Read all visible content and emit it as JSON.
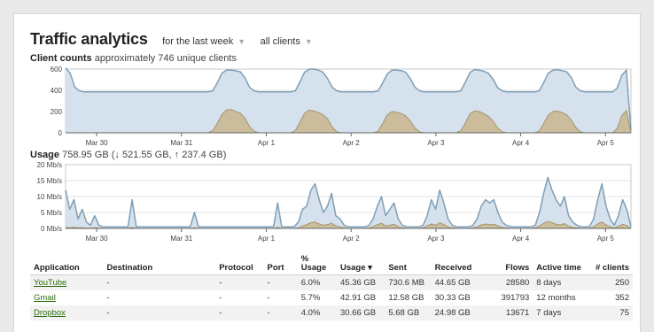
{
  "header": {
    "title": "Traffic analytics",
    "time_filter": "for the last week",
    "client_filter": "all clients"
  },
  "client_counts": {
    "label": "Client counts",
    "summary": "approximately 746 unique clients"
  },
  "usage": {
    "label": "Usage",
    "summary": "758.95 GB (↓ 521.55 GB, ↑ 237.4 GB)"
  },
  "table": {
    "headers": {
      "application": "Application",
      "destination": "Destination",
      "protocol": "Protocol",
      "port": "Port",
      "pct_usage": "% Usage",
      "usage": "Usage ▾",
      "sent": "Sent",
      "received": "Received",
      "flows": "Flows",
      "active_time": "Active time",
      "clients": "# clients"
    },
    "rows": [
      {
        "application": "YouTube",
        "destination": "-",
        "protocol": "-",
        "port": "-",
        "pct_usage": "6.0%",
        "usage": "45.36 GB",
        "sent": "730.6 MB",
        "received": "44.65 GB",
        "flows": "28580",
        "active_time": "8 days",
        "clients": "250"
      },
      {
        "application": "Gmail",
        "destination": "-",
        "protocol": "-",
        "port": "-",
        "pct_usage": "5.7%",
        "usage": "42.91 GB",
        "sent": "12.58 GB",
        "received": "30.33 GB",
        "flows": "391793",
        "active_time": "12 months",
        "clients": "352"
      },
      {
        "application": "Dropbox",
        "destination": "-",
        "protocol": "-",
        "port": "-",
        "pct_usage": "4.0%",
        "usage": "30.66 GB",
        "sent": "5.68 GB",
        "received": "24.98 GB",
        "flows": "13671",
        "active_time": "7 days",
        "clients": "75"
      }
    ]
  },
  "colors": {
    "total_fill": "#d5e1ec",
    "total_line": "#7f9fb5",
    "secondary_fill": "#cbbd9c",
    "secondary_line": "#a4946e",
    "link": "#2a6e0c"
  },
  "chart_data": [
    {
      "type": "area",
      "title": "Client counts",
      "x_ticks": [
        "Mar 30",
        "Mar 31",
        "Apr 1",
        "Apr 2",
        "Apr 3",
        "Apr 4",
        "Apr 5"
      ],
      "y_ticks": [
        "0",
        "200",
        "400",
        "600"
      ],
      "ylim": [
        0,
        600
      ],
      "grid": true,
      "series": [
        {
          "values": [
            610,
            560,
            430,
            395,
            385,
            385,
            385,
            385,
            385,
            385,
            385,
            385,
            385,
            385,
            385,
            385,
            385,
            385,
            385,
            385,
            385,
            385,
            385,
            385,
            385,
            385,
            385,
            385,
            385,
            385,
            385,
            385,
            395,
            470,
            560,
            590,
            590,
            585,
            575,
            520,
            430,
            395,
            385,
            385,
            385,
            385,
            385,
            385,
            385,
            385,
            395,
            480,
            570,
            600,
            600,
            590,
            570,
            510,
            430,
            395,
            385,
            385,
            385,
            385,
            385,
            385,
            385,
            385,
            395,
            470,
            555,
            590,
            590,
            585,
            570,
            510,
            430,
            395,
            385,
            385,
            385,
            385,
            385,
            385,
            385,
            385,
            395,
            480,
            570,
            595,
            590,
            580,
            560,
            505,
            425,
            395,
            385,
            385,
            385,
            385,
            385,
            385,
            385,
            395,
            470,
            560,
            590,
            595,
            585,
            575,
            520,
            430,
            395,
            385,
            385,
            385,
            385,
            385,
            385,
            385,
            420,
            540,
            590,
            20
          ]
        },
        {
          "values": [
            0,
            0,
            0,
            0,
            0,
            0,
            0,
            0,
            0,
            0,
            0,
            0,
            0,
            0,
            0,
            0,
            0,
            0,
            0,
            0,
            0,
            0,
            0,
            0,
            0,
            0,
            0,
            0,
            0,
            0,
            0,
            0,
            20,
            90,
            170,
            215,
            220,
            200,
            185,
            140,
            60,
            15,
            0,
            0,
            0,
            0,
            0,
            0,
            0,
            0,
            20,
            100,
            185,
            215,
            205,
            190,
            170,
            130,
            55,
            10,
            0,
            0,
            0,
            0,
            0,
            0,
            0,
            0,
            15,
            90,
            170,
            200,
            195,
            180,
            160,
            110,
            45,
            10,
            0,
            0,
            0,
            0,
            0,
            0,
            0,
            0,
            20,
            95,
            180,
            205,
            200,
            180,
            155,
            110,
            45,
            10,
            0,
            0,
            0,
            0,
            0,
            0,
            0,
            15,
            85,
            165,
            200,
            205,
            190,
            170,
            120,
            50,
            10,
            0,
            0,
            0,
            0,
            0,
            0,
            0,
            40,
            160,
            210,
            0
          ]
        }
      ]
    },
    {
      "type": "area",
      "title": "Usage",
      "x_ticks": [
        "Mar 30",
        "Mar 31",
        "Apr 1",
        "Apr 2",
        "Apr 3",
        "Apr 4",
        "Apr 5"
      ],
      "y_ticks": [
        "0 Mb/s",
        "5 Mb/s",
        "10 Mb/s",
        "15 Mb/s",
        "20 Mb/s"
      ],
      "ylim": [
        0,
        20
      ],
      "grid": true,
      "series": [
        {
          "values": [
            12,
            6,
            9,
            3,
            6,
            2,
            1,
            4,
            1,
            0.5,
            0.5,
            0.5,
            0.5,
            0.5,
            0.5,
            0.5,
            9,
            0.5,
            0.5,
            0.5,
            0.5,
            0.5,
            0.5,
            0.5,
            0.5,
            0.5,
            0.5,
            0.5,
            0.5,
            0.5,
            0.5,
            5,
            0.5,
            0.5,
            0.5,
            0.5,
            0.5,
            0.5,
            0.5,
            0.5,
            0.5,
            0.5,
            0.5,
            0.5,
            0.5,
            0.5,
            0.5,
            0.5,
            0.5,
            0.5,
            0.5,
            8,
            0.5,
            0.5,
            0.5,
            0.5,
            2,
            6,
            7,
            12,
            14,
            9,
            5,
            7,
            11,
            4,
            3,
            1,
            0.5,
            0.5,
            0.5,
            0.5,
            0.5,
            1,
            3,
            7,
            10,
            4,
            6,
            8,
            3,
            1,
            0.5,
            0.5,
            0.5,
            0.5,
            1,
            4,
            9,
            6,
            12,
            8,
            3,
            1,
            0.5,
            0.5,
            0.5,
            0.5,
            1,
            3,
            7,
            9,
            8,
            9,
            5,
            2,
            1,
            0.5,
            0.5,
            0.5,
            0.5,
            0.5,
            0.5,
            1,
            5,
            11,
            16,
            12,
            9,
            7,
            10,
            4,
            2,
            1,
            0.5,
            0.5,
            0.5,
            3,
            9,
            14,
            7,
            3,
            1,
            4,
            9,
            6,
            0.5
          ]
        },
        {
          "values": [
            0.3,
            0.2,
            0.3,
            0.2,
            0.2,
            0.1,
            0.1,
            0.2,
            0.1,
            0,
            0,
            0,
            0,
            0,
            0,
            0,
            0.3,
            0,
            0,
            0,
            0,
            0,
            0,
            0,
            0,
            0,
            0,
            0,
            0,
            0,
            0,
            0.2,
            0,
            0,
            0,
            0,
            0,
            0,
            0,
            0,
            0,
            0,
            0,
            0,
            0,
            0,
            0,
            0,
            0,
            0,
            0,
            0.3,
            0,
            0,
            0,
            0,
            0.2,
            0.8,
            1.2,
            1.8,
            2,
            1.4,
            1,
            1.2,
            1.6,
            0.8,
            0.5,
            0.2,
            0,
            0,
            0,
            0,
            0,
            0.2,
            0.6,
            1.2,
            1.6,
            0.8,
            1,
            1.3,
            0.6,
            0.2,
            0,
            0,
            0,
            0,
            0.2,
            0.8,
            1.4,
            1,
            1.8,
            1.2,
            0.5,
            0.2,
            0,
            0,
            0,
            0,
            0.2,
            0.5,
            1.1,
            1.4,
            1.2,
            1.3,
            0.8,
            0.3,
            0.2,
            0,
            0,
            0,
            0,
            0,
            0,
            0.2,
            0.8,
            1.6,
            2.2,
            1.8,
            1.3,
            1.1,
            1.5,
            0.7,
            0.3,
            0.2,
            0,
            0,
            0,
            0.5,
            1.4,
            2,
            1.1,
            0.5,
            0.2,
            0.7,
            1.3,
            0.9,
            0
          ]
        }
      ]
    }
  ]
}
